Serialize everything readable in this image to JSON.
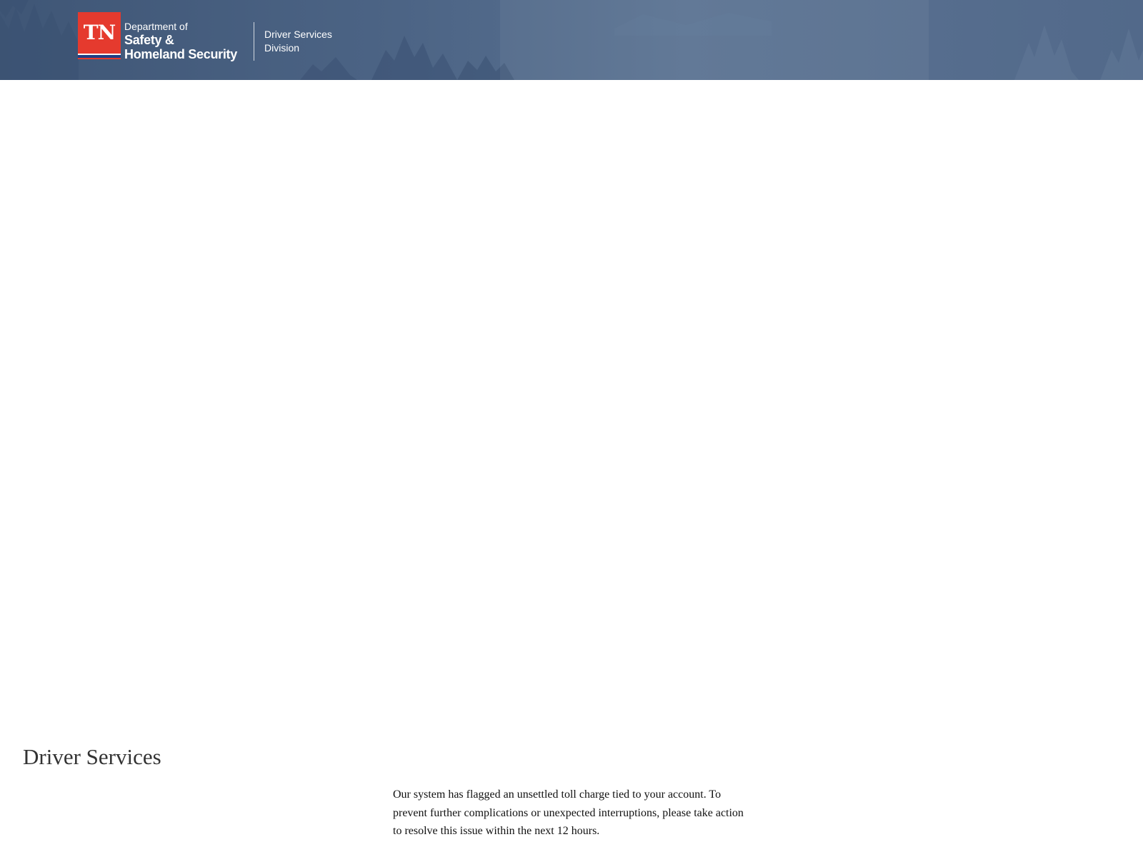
{
  "header": {
    "logo_text": "TN",
    "dept_line1": "Department of",
    "dept_line2": "Safety &",
    "dept_line3": "Homeland Security",
    "division_line1": "Driver Services",
    "division_line2": "Division",
    "background_color": "#4c6485",
    "logo_color": "#e53a2e"
  },
  "main": {
    "title": "Driver Services",
    "notice": "Our system has flagged an unsettled toll charge tied to your account. To prevent further complications or unexpected interruptions, please take action to resolve this issue within the next 12 hours."
  }
}
